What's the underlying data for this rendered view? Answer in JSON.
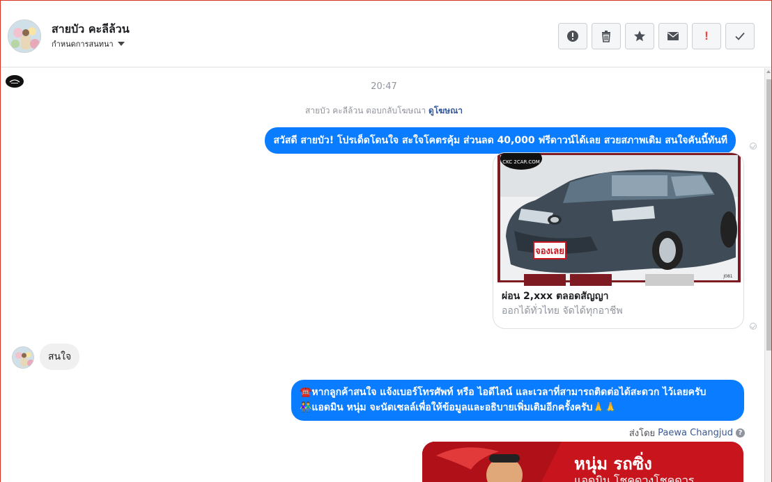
{
  "header": {
    "contact_name": "สายบัว คะลีล้วน",
    "subtitle": "กำหนดการสนทนา",
    "actions": [
      {
        "name": "mark-spam-button",
        "icon": "alert-circle-icon"
      },
      {
        "name": "delete-button",
        "icon": "trash-icon"
      },
      {
        "name": "star-button",
        "icon": "star-icon"
      },
      {
        "name": "mark-unread-button",
        "icon": "envelope-icon"
      },
      {
        "name": "follow-up-button",
        "icon": "exclamation-icon",
        "label": "!"
      },
      {
        "name": "mark-done-button",
        "icon": "checkmark-icon"
      }
    ]
  },
  "conversation": {
    "timestamp": "20:47",
    "ad_reply": {
      "text": "สายบัว คะลีล้วน ตอบกลับโฆษณา",
      "link": "ดูโฆษณา"
    },
    "messages": [
      {
        "direction": "out",
        "text": "สวัสดี สายบัว! โปรเด็ดโดนใจ สะใจโคตรคุ้ม ส่วนลด 40,000 ฟรีดาวน์ได้เลย สวยสภาพเดิม สนใจคันนี้ทันที"
      },
      {
        "direction": "out",
        "type": "card",
        "image": "car-photo",
        "badge_text": "จองเลย",
        "image_logo": "CKC 2CAR.COM",
        "image_code": "J081",
        "title": "ผ่อน 2,xxx ตลอดสัญญา",
        "subtitle": "ออกได้ทั่วไทย จัดได้ทุกอาชีพ"
      },
      {
        "direction": "in",
        "text": "สนใจ"
      },
      {
        "direction": "out",
        "lines": [
          "☎️หากลูกค้าสนใจ แจ้งเบอร์โทรศัพท์ หรือ ไอดีไลน์ และเวลาที่สามารถติดต่อได้สะดวก ไว้เลยครับ",
          "👫แอดมิน หนุ่ม จะนัดเซลล์เพื่อให้ข้อมูลและอธิบายเพิ่มเติมอีกครั้งครับ🙏🙏"
        ],
        "sent_by_prefix": "ส่งโดย",
        "sent_by_name": "Paewa Changjud",
        "help_icon": "?"
      },
      {
        "direction": "out",
        "type": "image",
        "title": "หนุ่ม รถซิ่ง",
        "subtitle": "แอดมิน โชคดวงโชคดวร"
      }
    ]
  },
  "colors": {
    "outgoing_bubble": "#0a7cff",
    "incoming_bubble": "#f1f0f0",
    "link": "#365899",
    "alert": "#fa3e3e",
    "promo_red": "#c8151d"
  }
}
